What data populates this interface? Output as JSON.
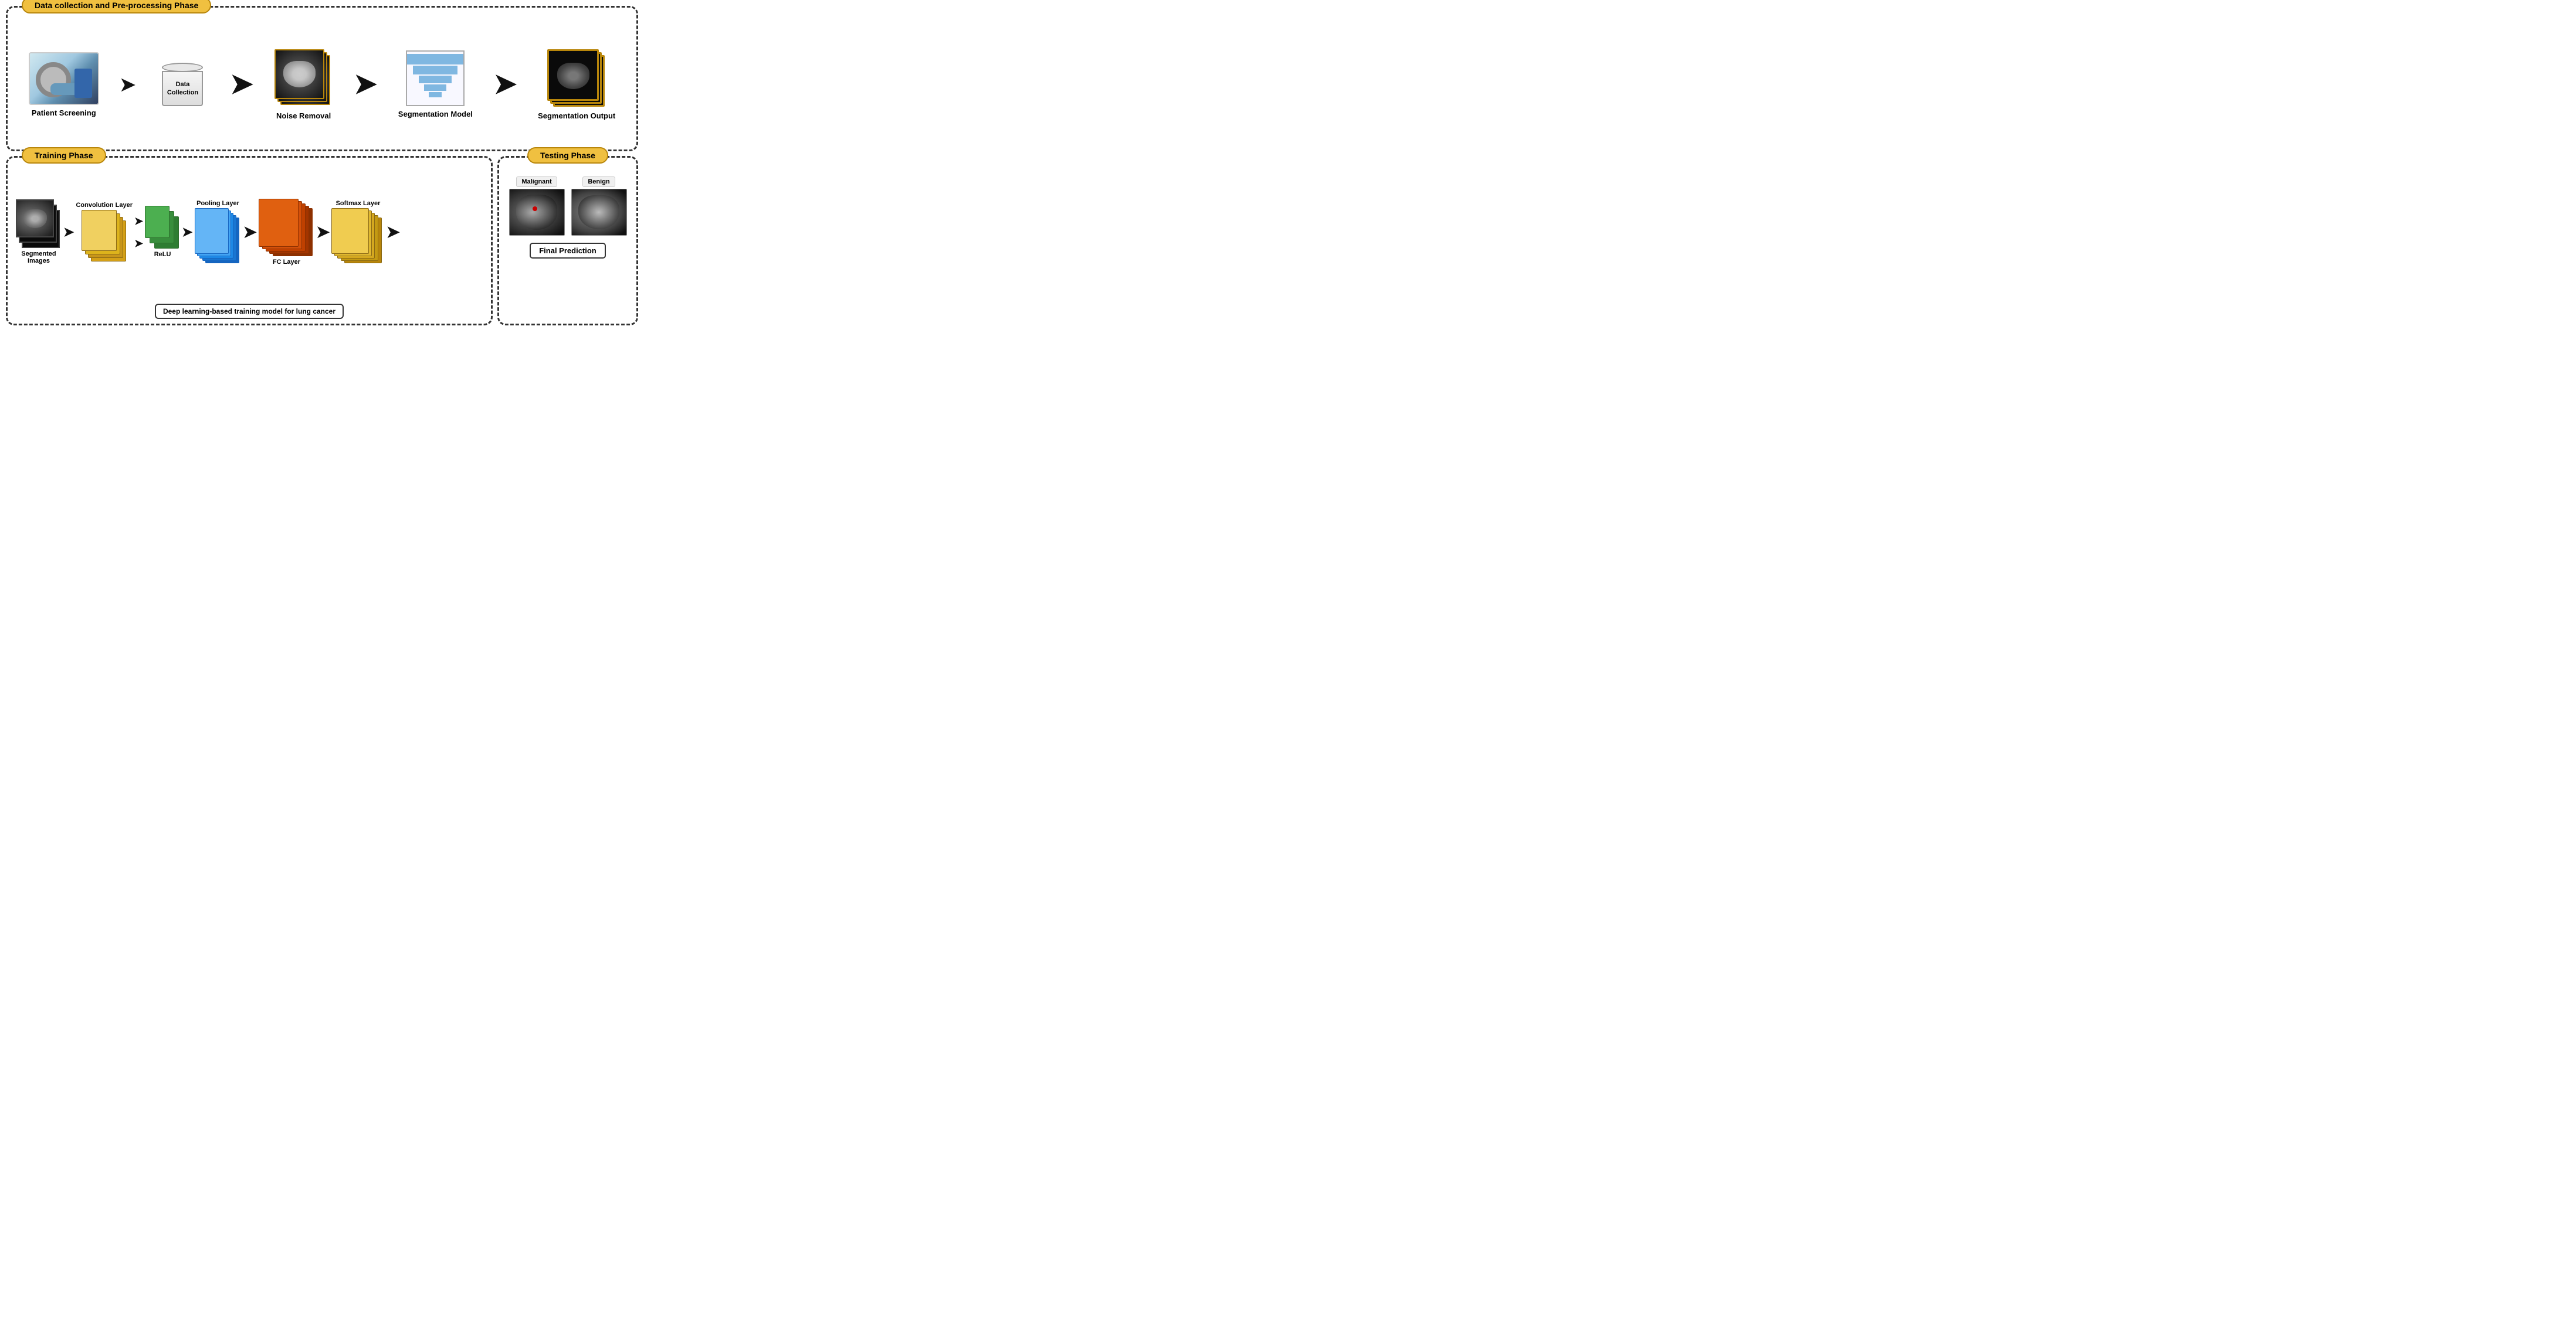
{
  "top_phase": {
    "label": "Data collection and Pre-processing Phase",
    "items": [
      {
        "id": "patient-screening",
        "label": "Patient Screening"
      },
      {
        "id": "data-collection",
        "label": "Data Collection"
      },
      {
        "id": "noise-removal",
        "label": "Noise Removal"
      },
      {
        "id": "segmentation-model",
        "label": "Segmentation Model"
      },
      {
        "id": "segmentation-output",
        "label": "Segmentation Output"
      }
    ]
  },
  "bottom_training": {
    "label": "Training Phase",
    "layers": [
      {
        "id": "segmented-images",
        "label": "Segmented Images"
      },
      {
        "id": "conv-layer",
        "label": "Convolution Layer"
      },
      {
        "id": "relu",
        "label": "ReLU"
      },
      {
        "id": "pooling-layer",
        "label": "Pooling Layer"
      },
      {
        "id": "fc-layer",
        "label": "FC Layer"
      },
      {
        "id": "softmax-layer",
        "label": "Softmax Layer"
      }
    ],
    "caption": "Deep learning-based training model for lung cancer"
  },
  "bottom_testing": {
    "label": "Testing Phase",
    "result_labels": [
      "Malignant",
      "Benign"
    ],
    "final_prediction": "Final Prediction"
  }
}
